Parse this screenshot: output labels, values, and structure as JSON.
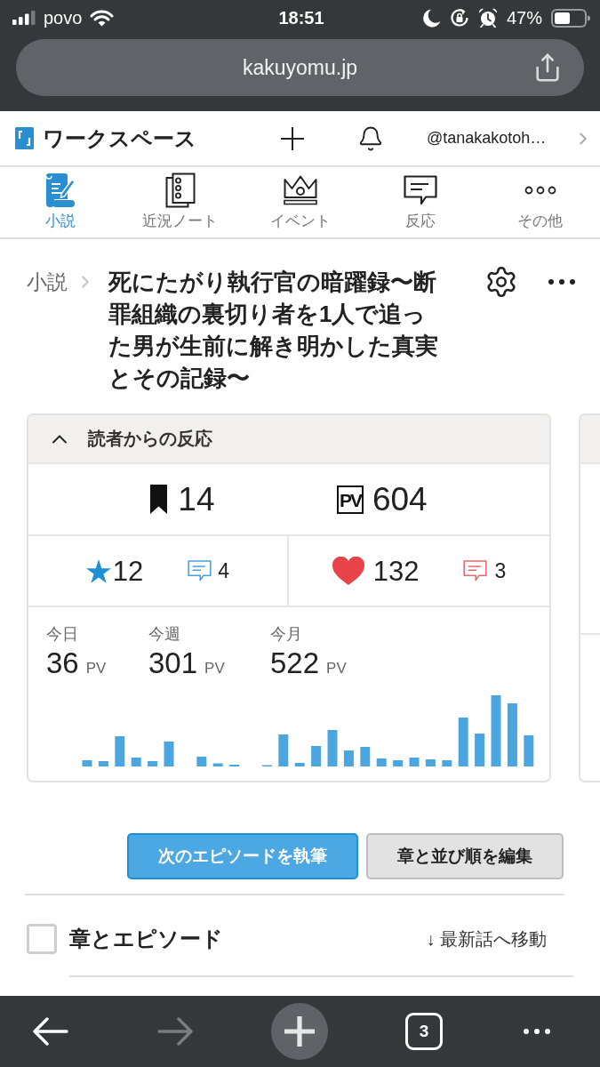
{
  "status_bar": {
    "carrier": "povo",
    "time": "18:51",
    "battery": "47%"
  },
  "address_bar": {
    "url": "kakuyomu.jp"
  },
  "header": {
    "title": "ワークスペース",
    "account": "@tanakakotoh…"
  },
  "nav_tabs": [
    {
      "label": "小説",
      "selected": true
    },
    {
      "label": "近況ノート",
      "selected": false
    },
    {
      "label": "イベント",
      "selected": false
    },
    {
      "label": "反応",
      "selected": false
    },
    {
      "label": "その他",
      "selected": false
    }
  ],
  "page": {
    "breadcrumb": "小説",
    "title": "死にたがり執行官の暗躍録〜断罪組織の裏切り者を1人で追った男が生前に解き明かした真実とその記録〜"
  },
  "reactions_card": {
    "title": "読者からの反応",
    "expanded": true,
    "followers": "14",
    "pv_label": "PV",
    "pv_total": "604",
    "stars": "12",
    "star_comments": "4",
    "hearts": "132",
    "heart_comments": "3",
    "periods": [
      {
        "label": "今日",
        "value": "36",
        "unit": "PV"
      },
      {
        "label": "今週",
        "value": "301",
        "unit": "PV"
      },
      {
        "label": "今月",
        "value": "522",
        "unit": "PV"
      }
    ]
  },
  "actions": [
    {
      "label": "次のエピソードを執筆",
      "kind": "primary"
    },
    {
      "label": "章と並び順を編集",
      "kind": "secondary"
    }
  ],
  "toc": {
    "title": "章とエピソード",
    "checked": false,
    "jump_link": "↓ 最新話へ移動"
  },
  "browser_toolbar": {
    "tab_count": "3",
    "forward_disabled": true
  }
}
